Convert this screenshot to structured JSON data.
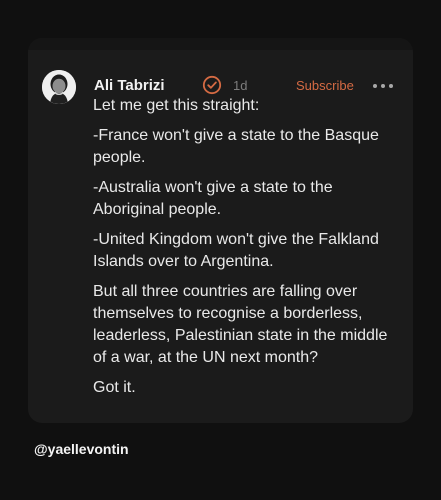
{
  "post": {
    "author": "Ali Tabrizi",
    "time": "1d",
    "subscribe_label": "Subscribe",
    "paragraphs": [
      "Let me get this straight:",
      "-France won't give a state to the Basque people.",
      "-Australia won't give a state to the Aboriginal people.",
      "-United Kingdom won't give the Falkland Islands over to Argentina.",
      "But all three countries are falling over themselves to recognise a borderless, leaderless, Palestinian state in the middle of a war, at the UN next month?",
      "Got it."
    ]
  },
  "footer": {
    "watermark": "@yaellevontin"
  },
  "icons": {
    "avatar": "avatar",
    "verified": "verified-check-icon",
    "more": "more-horizontal-icon"
  },
  "colors": {
    "background": "#101010",
    "card": "#1b1b1b",
    "text": "#e9e9e9",
    "accent": "#d46a43",
    "muted": "#7d7d7d"
  }
}
